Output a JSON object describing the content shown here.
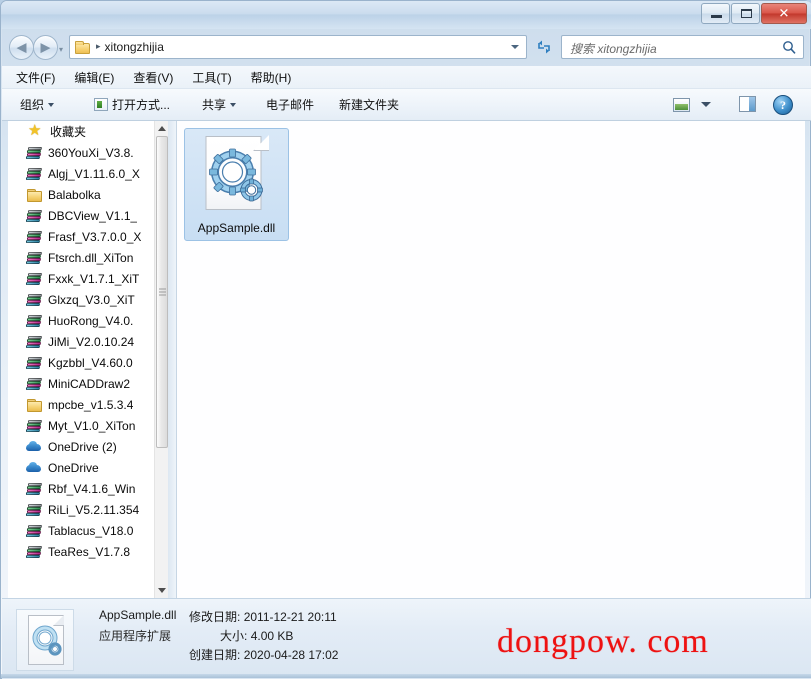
{
  "window": {
    "title": "",
    "controls": {
      "minimize": "Minimize",
      "maximize": "Maximize",
      "close": "✕"
    }
  },
  "navigation": {
    "back": "◀",
    "forward": "▶",
    "recent_dropdown": "▾",
    "address": {
      "folder_icon": "folder-icon",
      "separator": "▸",
      "crumb": "xitongzhijia",
      "dropdown": "▾"
    },
    "refresh_icon": "refresh-icon"
  },
  "search": {
    "placeholder": "搜索 xitongzhijia",
    "icon": "search-icon"
  },
  "menubar": {
    "items": [
      {
        "label": "文件(F)"
      },
      {
        "label": "编辑(E)"
      },
      {
        "label": "查看(V)"
      },
      {
        "label": "工具(T)"
      },
      {
        "label": "帮助(H)"
      }
    ]
  },
  "toolbar": {
    "organize": "组织",
    "open_with": "打开方式...",
    "share": "共享",
    "email": "电子邮件",
    "new_folder": "新建文件夹",
    "preview_icon": "preview-pane-icon",
    "view_dropdown": "▾",
    "pane_icon": "layout-pane-icon",
    "help_icon": "?"
  },
  "sidebar": {
    "header": {
      "label": "收藏夹",
      "icon": "star-icon"
    },
    "items": [
      {
        "label": "360YouXi_V3.8.",
        "icon": "archive-icon"
      },
      {
        "label": "Algj_V1.11.6.0_X",
        "icon": "archive-icon"
      },
      {
        "label": "Balabolka",
        "icon": "folder-icon"
      },
      {
        "label": "DBCView_V1.1_",
        "icon": "archive-icon"
      },
      {
        "label": "Frasf_V3.7.0.0_X",
        "icon": "archive-icon"
      },
      {
        "label": "Ftsrch.dll_XiTon",
        "icon": "archive-icon"
      },
      {
        "label": "Fxxk_V1.7.1_XiT",
        "icon": "archive-icon"
      },
      {
        "label": "Glxzq_V3.0_XiT",
        "icon": "archive-icon"
      },
      {
        "label": "HuoRong_V4.0.",
        "icon": "archive-icon"
      },
      {
        "label": "JiMi_V2.0.10.24",
        "icon": "archive-icon"
      },
      {
        "label": "Kgzbbl_V4.60.0",
        "icon": "archive-icon"
      },
      {
        "label": "MiniCADDraw2",
        "icon": "archive-icon"
      },
      {
        "label": "mpcbe_v1.5.3.4",
        "icon": "folder-icon"
      },
      {
        "label": "Myt_V1.0_XiTon",
        "icon": "archive-icon"
      },
      {
        "label": "OneDrive (2)",
        "icon": "cloud-icon"
      },
      {
        "label": "OneDrive",
        "icon": "cloud-icon"
      },
      {
        "label": "Rbf_V4.1.6_Win",
        "icon": "archive-icon"
      },
      {
        "label": "RiLi_V5.2.11.354",
        "icon": "archive-icon"
      },
      {
        "label": "Tablacus_V18.0",
        "icon": "archive-icon"
      },
      {
        "label": "TeaRes_V1.7.8",
        "icon": "archive-icon"
      }
    ],
    "scrollbar": {
      "up": "▲",
      "down": "▼"
    }
  },
  "files": [
    {
      "name": "AppSample.dll",
      "icon": "dll-gear-icon",
      "selected": true
    }
  ],
  "details": {
    "name": "AppSample.dll",
    "type": "应用程序扩展",
    "modified_key": "修改日期:",
    "modified_value": "2011-12-21 20:11",
    "size_key": "大小:",
    "size_value": "4.00 KB",
    "created_key": "创建日期:",
    "created_value": "2020-04-28 17:02"
  },
  "watermark": {
    "text": "dongpow. com",
    "color": "#ee1111"
  },
  "colors": {
    "frame": "#9ab3cc",
    "content_bg": "#ffffff",
    "selection": "#c8def3",
    "accent": "#3e8fcb"
  }
}
